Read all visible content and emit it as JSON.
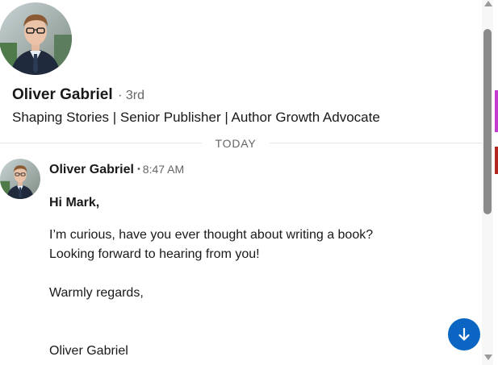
{
  "profile": {
    "name": "Oliver Gabriel",
    "degree": "· 3rd",
    "headline": "Shaping Stories | Senior Publisher | Author Growth Advocate",
    "avatar_icon": "profile-photo"
  },
  "divider": {
    "label": "TODAY"
  },
  "message": {
    "sender": "Oliver Gabriel",
    "bullet": "•",
    "time": "8:47 AM",
    "greeting": "Hi Mark,",
    "line1": "I’m curious, have you ever thought about writing a book?",
    "line2": "Looking forward to hearing from you!",
    "closing": "Warmly regards,",
    "signature": "Oliver Gabriel"
  },
  "scroll_button": {
    "icon": "arrow-down-icon",
    "color": "#0a66c2"
  },
  "colors": {
    "accent": "#0a66c2",
    "text": "#191919",
    "muted": "#666666"
  }
}
